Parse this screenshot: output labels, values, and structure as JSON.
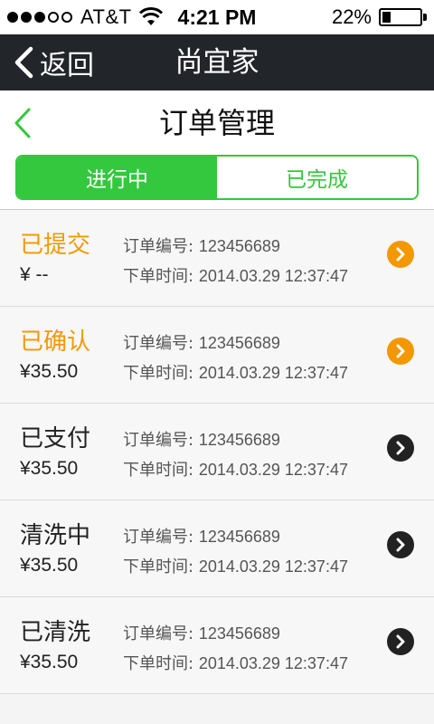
{
  "statusbar": {
    "carrier": "AT&T",
    "time": "4:21 PM",
    "battery": "22%",
    "battery_level": 0.22,
    "signal_bars": 3,
    "signal_total": 5
  },
  "topnav": {
    "back_label": "返回",
    "title": "尚宜家"
  },
  "page": {
    "title": "订单管理"
  },
  "tabs": [
    {
      "label": "进行中",
      "active": true
    },
    {
      "label": "已完成",
      "active": false
    }
  ],
  "labels": {
    "order_no": "订单编号:",
    "order_time": "下单时间:"
  },
  "orders": [
    {
      "status": "已提交",
      "status_color": "#f39800",
      "price": "¥ --",
      "order_no": "123456689",
      "order_time": "2014.03.29  12:37:47"
    },
    {
      "status": "已确认",
      "status_color": "#f39800",
      "price": "¥35.50",
      "order_no": "123456689",
      "order_time": "2014.03.29  12:37:47"
    },
    {
      "status": "已支付",
      "status_color": "#222222",
      "price": "¥35.50",
      "order_no": "123456689",
      "order_time": "2014.03.29  12:37:47"
    },
    {
      "status": "清洗中",
      "status_color": "#222222",
      "price": "¥35.50",
      "order_no": "123456689",
      "order_time": "2014.03.29  12:37:47"
    },
    {
      "status": "已清洗",
      "status_color": "#222222",
      "price": "¥35.50",
      "order_no": "123456689",
      "order_time": "2014.03.29  12:37:47"
    }
  ],
  "colors": {
    "accent": "#33c83d",
    "pending": "#f39800",
    "nav_bg": "#22262a"
  }
}
